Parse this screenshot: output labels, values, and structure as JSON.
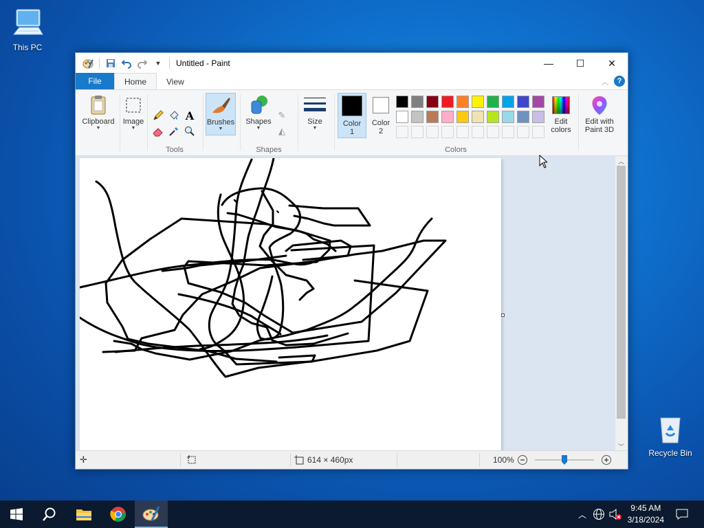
{
  "desktop": {
    "icons": [
      {
        "label": "This PC"
      },
      {
        "label": "Recycle Bin"
      }
    ]
  },
  "window": {
    "title": "Untitled - Paint",
    "tabs": [
      "File",
      "Home",
      "View"
    ],
    "ribbon": {
      "clipboard": "Clipboard",
      "image": "Image",
      "tools_group": "Tools",
      "brushes": "Brushes",
      "shapes": "Shapes",
      "shapes_group": "Shapes",
      "size": "Size",
      "color1": "Color 1",
      "color1_l1": "Color",
      "color1_l2": "1",
      "color2_l1": "Color",
      "color2_l2": "2",
      "edit_colors_l1": "Edit",
      "edit_colors_l2": "colors",
      "paint3d_l1": "Edit with",
      "paint3d_l2": "Paint 3D",
      "colors_group": "Colors",
      "palette_row1": [
        "#000000",
        "#7f7f7f",
        "#880015",
        "#ed1c24",
        "#ff7f27",
        "#fff200",
        "#22b14c",
        "#00a2e8",
        "#3f48cc",
        "#a349a4"
      ],
      "palette_row2": [
        "#ffffff",
        "#c3c3c3",
        "#b97a57",
        "#ffaec9",
        "#ffc90e",
        "#efe4b0",
        "#b5e61d",
        "#99d9ea",
        "#7092be",
        "#c8bfe7"
      ]
    },
    "status": {
      "dimensions": "614 × 460px",
      "zoom": "100%",
      "zoom_level": 0.5
    }
  },
  "taskbar": {
    "time": "9:45 AM",
    "date": "3/18/2024"
  }
}
